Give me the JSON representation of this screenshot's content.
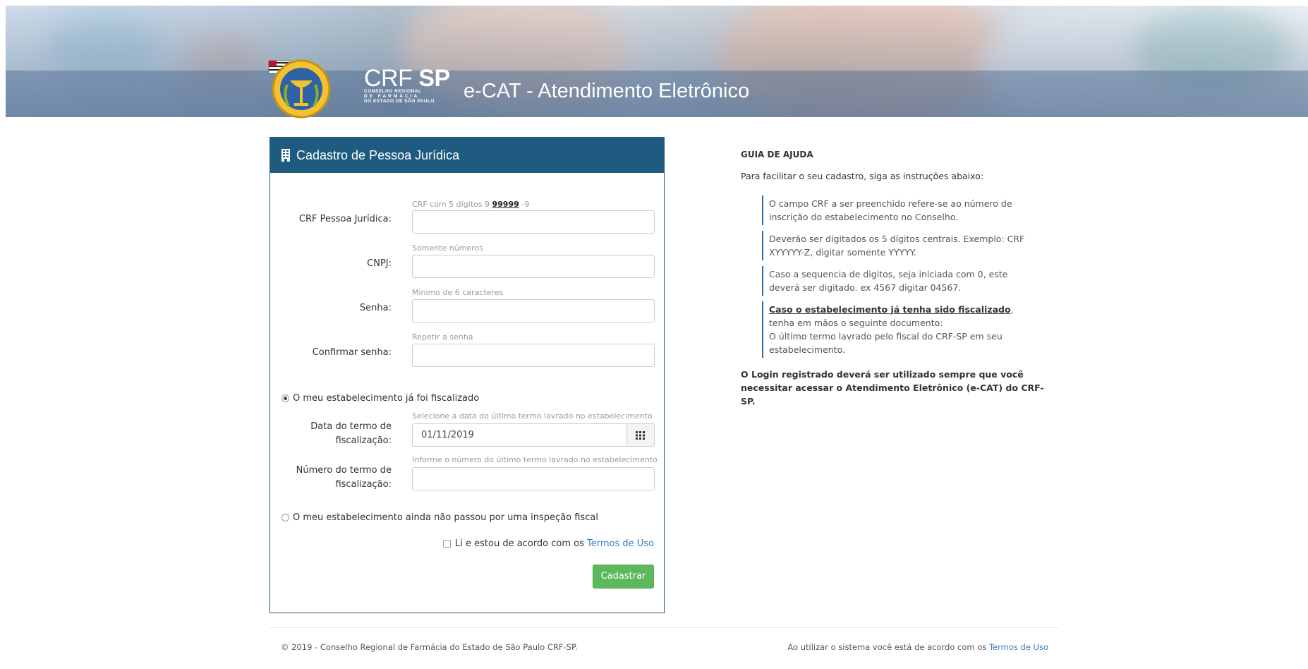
{
  "header": {
    "brand_main": "CRF",
    "brand_bold": "SP",
    "brand_line1": "CONSELHO REGIONAL",
    "brand_line2": "DE FARMÁCIA",
    "brand_line3": "DO ESTADO DE SÃO PAULO",
    "app_title": "e-CAT - Atendimento Eletrônico"
  },
  "form": {
    "title": "Cadastro de Pessoa Jurídica",
    "crf": {
      "label": "CRF Pessoa Jurídica:",
      "hint_prefix": "CRF com 5 dígitos 9 ",
      "hint_bold": "99999",
      "hint_suffix": " -9",
      "value": ""
    },
    "cnpj": {
      "label": "CNPJ:",
      "hint": "Somente números",
      "value": ""
    },
    "senha": {
      "label": "Senha:",
      "hint": "Mínimo de 6 caracteres",
      "value": ""
    },
    "confirmar": {
      "label": "Confirmar senha:",
      "hint": "Repetir a senha",
      "value": ""
    },
    "radio_fiscalizado": {
      "label": "O meu estabelecimento já foi fiscalizado",
      "selected": true
    },
    "data_termo": {
      "label_line1": "Data do termo de",
      "label_line2": "fiscalização:",
      "hint": "Selecione a data do último termo lavrado no estabelecimento",
      "value": "01/11/2019"
    },
    "numero_termo": {
      "label_line1": "Número do termo de",
      "label_line2": "fiscalização:",
      "hint": "Informe o número do último termo lavrado no estabelecimento",
      "value": ""
    },
    "radio_nao_fiscalizado": {
      "label": "O meu estabelecimento ainda não passou por uma inspeção fiscal",
      "selected": false
    },
    "terms_text": "Li e estou de acordo com os ",
    "terms_link": "Termos de Uso",
    "submit_label": "Cadastrar"
  },
  "guide": {
    "title": "GUIA DE AJUDA",
    "intro": "Para facilitar o seu cadastro, siga as instruções abaixo:",
    "item1": "O campo CRF a ser preenchido refere-se ao número de inscrição do estabelecimento no Conselho.",
    "item2": "Deverão ser digitados os 5 dígitos centrais. Exemplo: CRF XYYYYY-Z, digitar somente YYYYY.",
    "item3": "Caso a sequencia de digitos, seja iniciada com 0, este deverá ser digitado. ex 4567 digitar 04567.",
    "item4_link": "Caso o estabelecimento já tenha sido fiscalizado",
    "item4_rest": ", tenha em mãos o seguinte documento:",
    "item4_line2": "O último termo lavrado pelo fiscal do CRF-SP em seu estabelecimento.",
    "note": "O Login registrado deverá ser utilizado sempre que você necessitar acessar o Atendimento Eletrônico (e-CAT) do CRF-SP."
  },
  "footer": {
    "copyright": "© 2019 - Conselho Regional de Farmácia do Estado de São Paulo CRF-SP.",
    "terms_prefix": "Ao utilizar o sistema você está de acordo com os ",
    "terms_link": "Termos de Uso"
  },
  "colors": {
    "panel_header": "#1f5a80",
    "submit_button": "#5cb85c",
    "link": "#3a7bbf",
    "guide_border": "#2a6f9a"
  },
  "icons": {
    "panel_title_icon": "building-icon",
    "calendar_button_icon": "calendar-grid-icon"
  }
}
